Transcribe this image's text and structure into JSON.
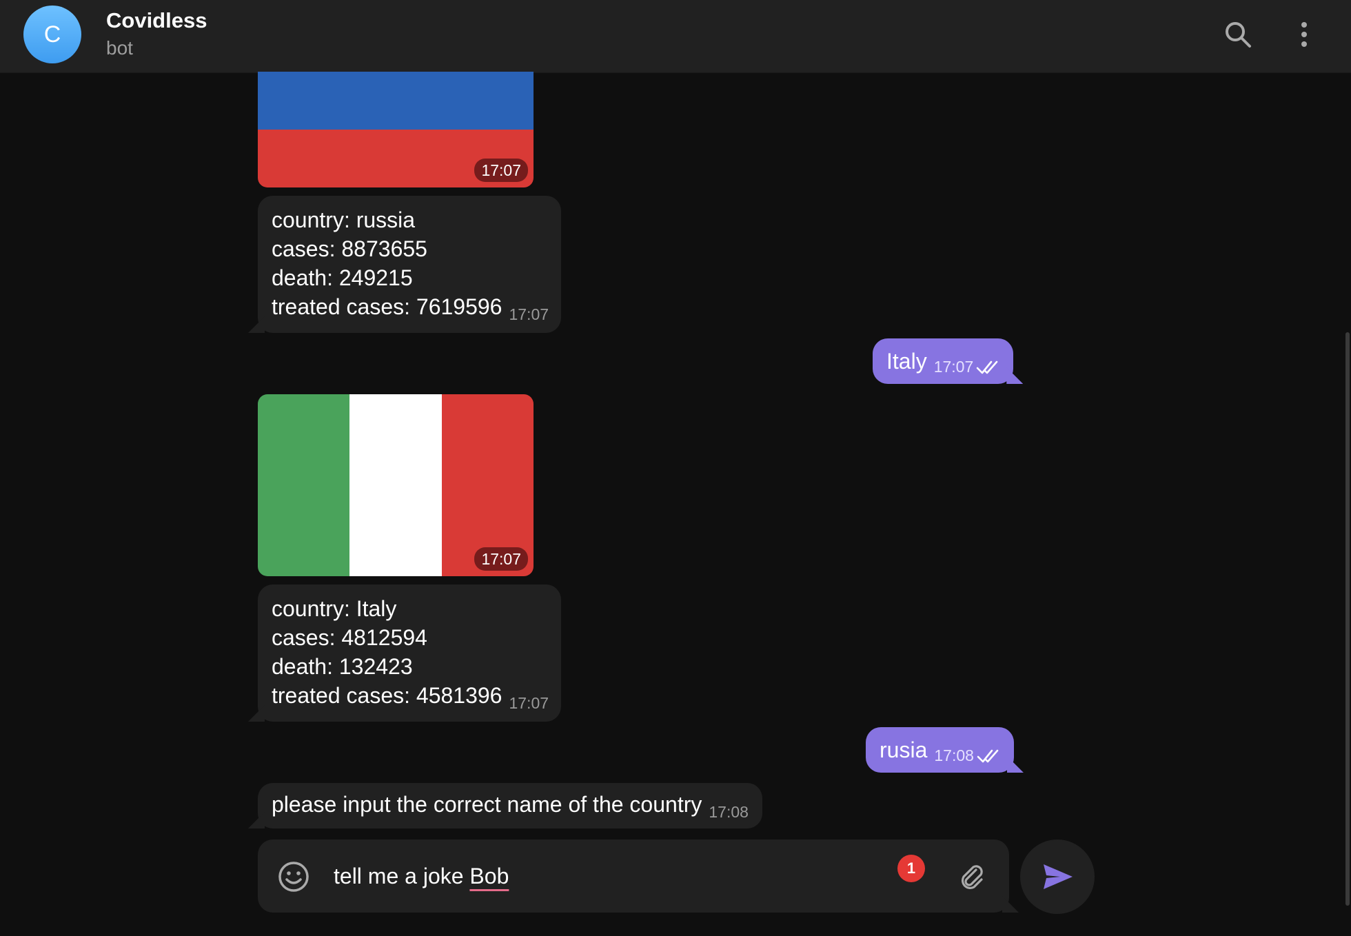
{
  "header": {
    "avatar_letter": "C",
    "title": "Covidless",
    "subtitle": "bot"
  },
  "messages": [
    {
      "type": "image",
      "flag": "russia-flag",
      "time": "17:07",
      "colors": [
        "#2a62b6",
        "#d93a36"
      ]
    },
    {
      "type": "incoming",
      "lines": [
        "country: russia",
        "cases: 8873655",
        "death: 249215",
        "treated cases: 7619596"
      ],
      "time": "17:07"
    },
    {
      "type": "outgoing",
      "text": "Italy",
      "time": "17:07"
    },
    {
      "type": "image",
      "flag": "italy-flag",
      "time": "17:07",
      "colors": [
        "#4aa35b",
        "#ffffff",
        "#d93a36"
      ]
    },
    {
      "type": "incoming",
      "lines": [
        "country: Italy",
        "cases: 4812594",
        "death: 132423",
        "treated cases: 4581396"
      ],
      "time": "17:07"
    },
    {
      "type": "outgoing",
      "text": "rusia",
      "time": "17:08"
    },
    {
      "type": "incoming",
      "lines": [
        "please input the correct name of the country"
      ],
      "time": "17:08"
    }
  ],
  "composer": {
    "text_before": "tell me a joke ",
    "text_misspelled": "Bob",
    "badge_count": "1"
  },
  "theme": {
    "accent": "#8774e1",
    "bubble_incoming": "#212121",
    "background": "#0f0f0f",
    "badge": "#e53935"
  },
  "icons": [
    "search-icon",
    "more-vertical-icon",
    "emoji-icon",
    "paperclip-icon",
    "send-icon",
    "double-check-icon"
  ]
}
